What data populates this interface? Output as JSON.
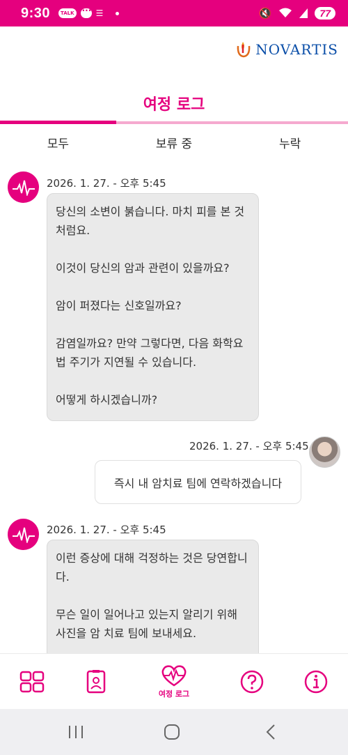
{
  "status": {
    "time": "9:30",
    "talk_badge": "TALK",
    "battery": "77"
  },
  "brand": {
    "name": "NOVARTIS"
  },
  "page": {
    "title": "여정 로그",
    "tabs": [
      "모두",
      "보류 중",
      "누락"
    ],
    "active_tab_index": 0
  },
  "messages": [
    {
      "sender": "bot",
      "timestamp": "2026. 1. 27. - 오후 5:45",
      "paragraphs": [
        "당신의 소변이 붉습니다. 마치 피를 본 것처럼요.",
        "이것이 당신의 암과 관련이 있을까요?",
        "암이 퍼졌다는 신호일까요?",
        "감염일까요? 만약 그렇다면, 다음 화학요법 주기가 지연될 수 있습니다.",
        "어떻게 하시겠습니까?"
      ]
    },
    {
      "sender": "user",
      "timestamp": "2026. 1. 27. - 오후 5:45",
      "text": "즉시 내 암치료 팀에 연락하겠습니다"
    },
    {
      "sender": "bot",
      "timestamp": "2026. 1. 27. - 오후 5:45",
      "paragraphs": [
        "이런 증상에 대해 걱정하는 것은 당연합니다.",
        "무슨 일이 일어나고 있는지 알리기 위해 사진을 암 치료 팀에 보내세요."
      ]
    }
  ],
  "bottom_nav": {
    "items": [
      {
        "icon": "grid-icon",
        "label": ""
      },
      {
        "icon": "id-badge-icon",
        "label": ""
      },
      {
        "icon": "heart-pulse-icon",
        "label": "여정 로그"
      },
      {
        "icon": "help-icon",
        "label": ""
      },
      {
        "icon": "info-icon",
        "label": ""
      }
    ],
    "active_index": 2
  },
  "colors": {
    "accent": "#e5007e",
    "brand_blue": "#0a4ea8",
    "bubble_bg": "#eaeaea"
  }
}
